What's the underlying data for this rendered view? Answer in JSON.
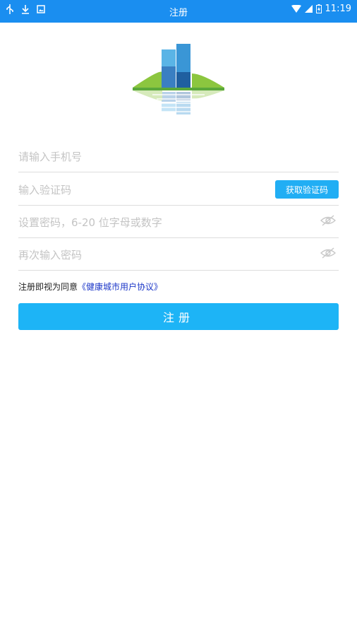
{
  "status_bar": {
    "title": "注册",
    "time": "11:19"
  },
  "form": {
    "phone_placeholder": "请输入手机号",
    "code_placeholder": "输入验证码",
    "get_code_label": "获取验证码",
    "password_placeholder": "设置密码，6-20 位字母或数字",
    "confirm_placeholder": "再次输入密码"
  },
  "agreement": {
    "prefix": "注册即视为同意",
    "link": "《健康城市用户协议》"
  },
  "submit_label": "注册",
  "colors": {
    "status_bar": "#1a8ef0",
    "button": "#1db4f6",
    "link": "#1c37c8"
  }
}
